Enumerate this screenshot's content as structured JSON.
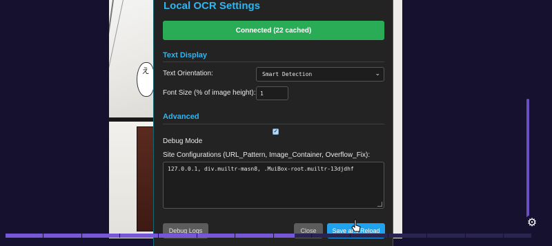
{
  "panel": {
    "title": "Local OCR Settings",
    "status": "Connected (22 cached)",
    "colors": {
      "accent": "#2fb6f0",
      "status_ok": "#2aab55",
      "save": "#1fa3f0"
    }
  },
  "text_display": {
    "heading": "Text Display",
    "orientation_label": "Text Orientation:",
    "orientation_value": "Smart Detection",
    "font_size_label": "Font Size (% of image height):",
    "font_size_value": "1"
  },
  "advanced": {
    "heading": "Advanced",
    "debug_mode_label": "Debug Mode",
    "debug_mode_checked": true,
    "site_config_label": "Site Configurations (URL_Pattern, Image_Container, Overflow_Fix):",
    "site_config_value": "127.0.0.1, div.muiltr-masn8, .MuiBox-root.muiltr-13djdhf"
  },
  "buttons": {
    "debug_logs": "Debug Logs",
    "close": "Close",
    "save_reload": "Save and Reload"
  },
  "manga": {
    "bubble_text": "え"
  },
  "reader": {
    "page_progress_fraction": 0.55,
    "settings_icon": "gear-icon"
  }
}
